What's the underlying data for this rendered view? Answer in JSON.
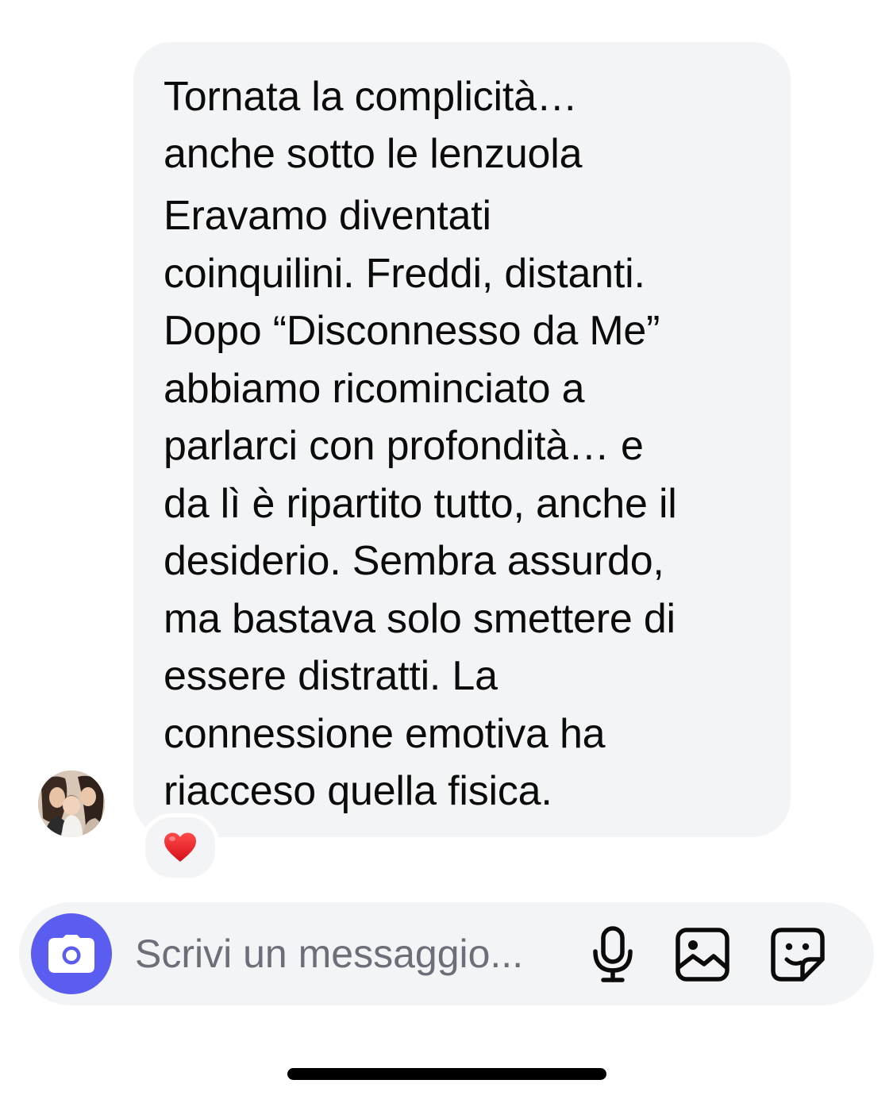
{
  "message": {
    "title_lines": [
      "Tornata la complicità…",
      "anche sotto le lenzuola"
    ],
    "body_lines": [
      "Eravamo diventati",
      "coinquilini. Freddi, distanti.",
      "Dopo “Disconnesso da Me”",
      "abbiamo ricominciato a",
      "parlarci con profondità… e",
      "da lì è ripartito tutto, anche il",
      "desiderio. Sembra assurdo,",
      "ma bastava solo smettere di",
      "essere distratti. La",
      "connessione emotiva ha",
      "riacceso quella fisica."
    ],
    "reaction": "❤️"
  },
  "composer": {
    "placeholder": "Scrivi un messaggio...",
    "value": ""
  },
  "icons": {
    "camera": "camera-icon",
    "mic": "microphone-icon",
    "gallery": "image-icon",
    "sticker": "sticker-icon"
  },
  "colors": {
    "bubble": "#f3f4f6",
    "camera_button": "#5b5cf0",
    "composer": "#f3f4f6",
    "placeholder": "#6b6f78"
  }
}
